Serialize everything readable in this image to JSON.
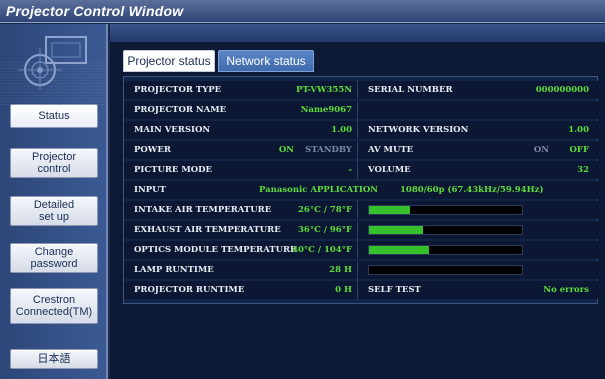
{
  "window": {
    "title": "Projector Control Window"
  },
  "sidebar": {
    "buttons": [
      {
        "label": "Status"
      },
      {
        "label": "Projector\ncontrol"
      },
      {
        "label": "Detailed\nset up"
      },
      {
        "label": "Change\npassword"
      },
      {
        "label": "Crestron\nConnected(TM)"
      },
      {
        "label": "日本語"
      }
    ]
  },
  "tabs": [
    {
      "label": "Projector status",
      "active": true
    },
    {
      "label": "Network status",
      "active": false
    }
  ],
  "status": {
    "projector_type_label": "PROJECTOR TYPE",
    "projector_type_value": "PT-VW355N",
    "serial_number_label": "SERIAL NUMBER",
    "serial_number_value": "000000000",
    "projector_name_label": "PROJECTOR NAME",
    "projector_name_value": "Name9067",
    "main_version_label": "MAIN VERSION",
    "main_version_value": "1.00",
    "network_version_label": "NETWORK VERSION",
    "network_version_value": "1.00",
    "power_label": "POWER",
    "power_on": "ON",
    "power_standby": "STANDBY",
    "av_mute_label": "AV MUTE",
    "av_mute_on": "ON",
    "av_mute_off": "OFF",
    "picture_mode_label": "PICTURE MODE",
    "picture_mode_value": "-",
    "volume_label": "VOLUME",
    "volume_value": "32",
    "input_label": "INPUT",
    "input_value": "Panasonic APPLICATION",
    "input_signal": "1080/60p (67.43kHz/59.94Hz)",
    "intake_temp_label": "INTAKE AIR TEMPERATURE",
    "intake_temp_value": "26°C / 78°F",
    "intake_temp_level": 0.27,
    "exhaust_temp_label": "EXHAUST AIR TEMPERATURE",
    "exhaust_temp_value": "36°C / 96°F",
    "exhaust_temp_level": 0.35,
    "optics_temp_label": "OPTICS MODULE TEMPERATURE",
    "optics_temp_value": "40°C / 104°F",
    "optics_temp_level": 0.39,
    "lamp_runtime_label": "LAMP RUNTIME",
    "lamp_runtime_value": "28 H",
    "lamp_runtime_level": 0.0,
    "projector_runtime_label": "PROJECTOR RUNTIME",
    "projector_runtime_value": "0 H",
    "self_test_label": "SELF TEST",
    "self_test_value": "No errors"
  },
  "colors": {
    "value_green": "#5edc3a",
    "bar_green": "#35c12c",
    "label_white": "#e8ecf4",
    "title_bar": "#2e4577"
  },
  "icons": {
    "logo": "projector-logo-icon"
  }
}
